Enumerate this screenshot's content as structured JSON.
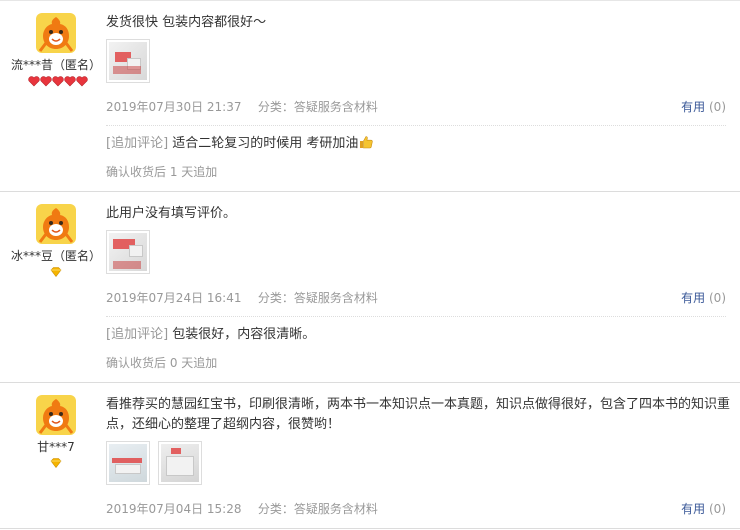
{
  "reviews": [
    {
      "user": "流***昔（匿名）",
      "level_icon": "heart-icon",
      "level_count": 5,
      "text": "发货很快 包装内容都很好～",
      "photos": 1,
      "date": "2019年07月30日 21:37",
      "category": "分类：答疑服务含材料",
      "useful_label": "有用",
      "useful_count": "(0)",
      "append_tag": "[追加评论]",
      "append_text": "适合二轮复习的时候用 考研加油",
      "append_emoji": "thumbs-up-icon",
      "append_after": "确认收货后 1 天追加"
    },
    {
      "user": "冰***豆（匿名）",
      "level_icon": "diamond-icon",
      "level_count": 1,
      "text": "此用户没有填写评价。",
      "photos": 1,
      "date": "2019年07月24日 16:41",
      "category": "分类：答疑服务含材料",
      "useful_label": "有用",
      "useful_count": "(0)",
      "append_tag": "[追加评论]",
      "append_text": "包装很好，内容很清晰。",
      "append_after": "确认收货后 0 天追加"
    },
    {
      "user": "甘***7",
      "level_icon": "diamond-icon",
      "level_count": 1,
      "text": "看推荐买的慧园红宝书，印刷很清晰，两本书一本知识点一本真题，知识点做得很好，包含了四本书的知识重点，还细心的整理了超纲内容，很赞哟！",
      "photos": 2,
      "date": "2019年07月04日 15:28",
      "category": "分类：答疑服务含材料",
      "useful_label": "有用",
      "useful_count": "(0)"
    }
  ],
  "colors": {
    "avatar_bg": "#f8d44a",
    "avatar_figure": "#f07a12",
    "heart": "#e8353d",
    "diamond": "#f5b400",
    "link": "#3b5998",
    "muted": "#999999"
  }
}
